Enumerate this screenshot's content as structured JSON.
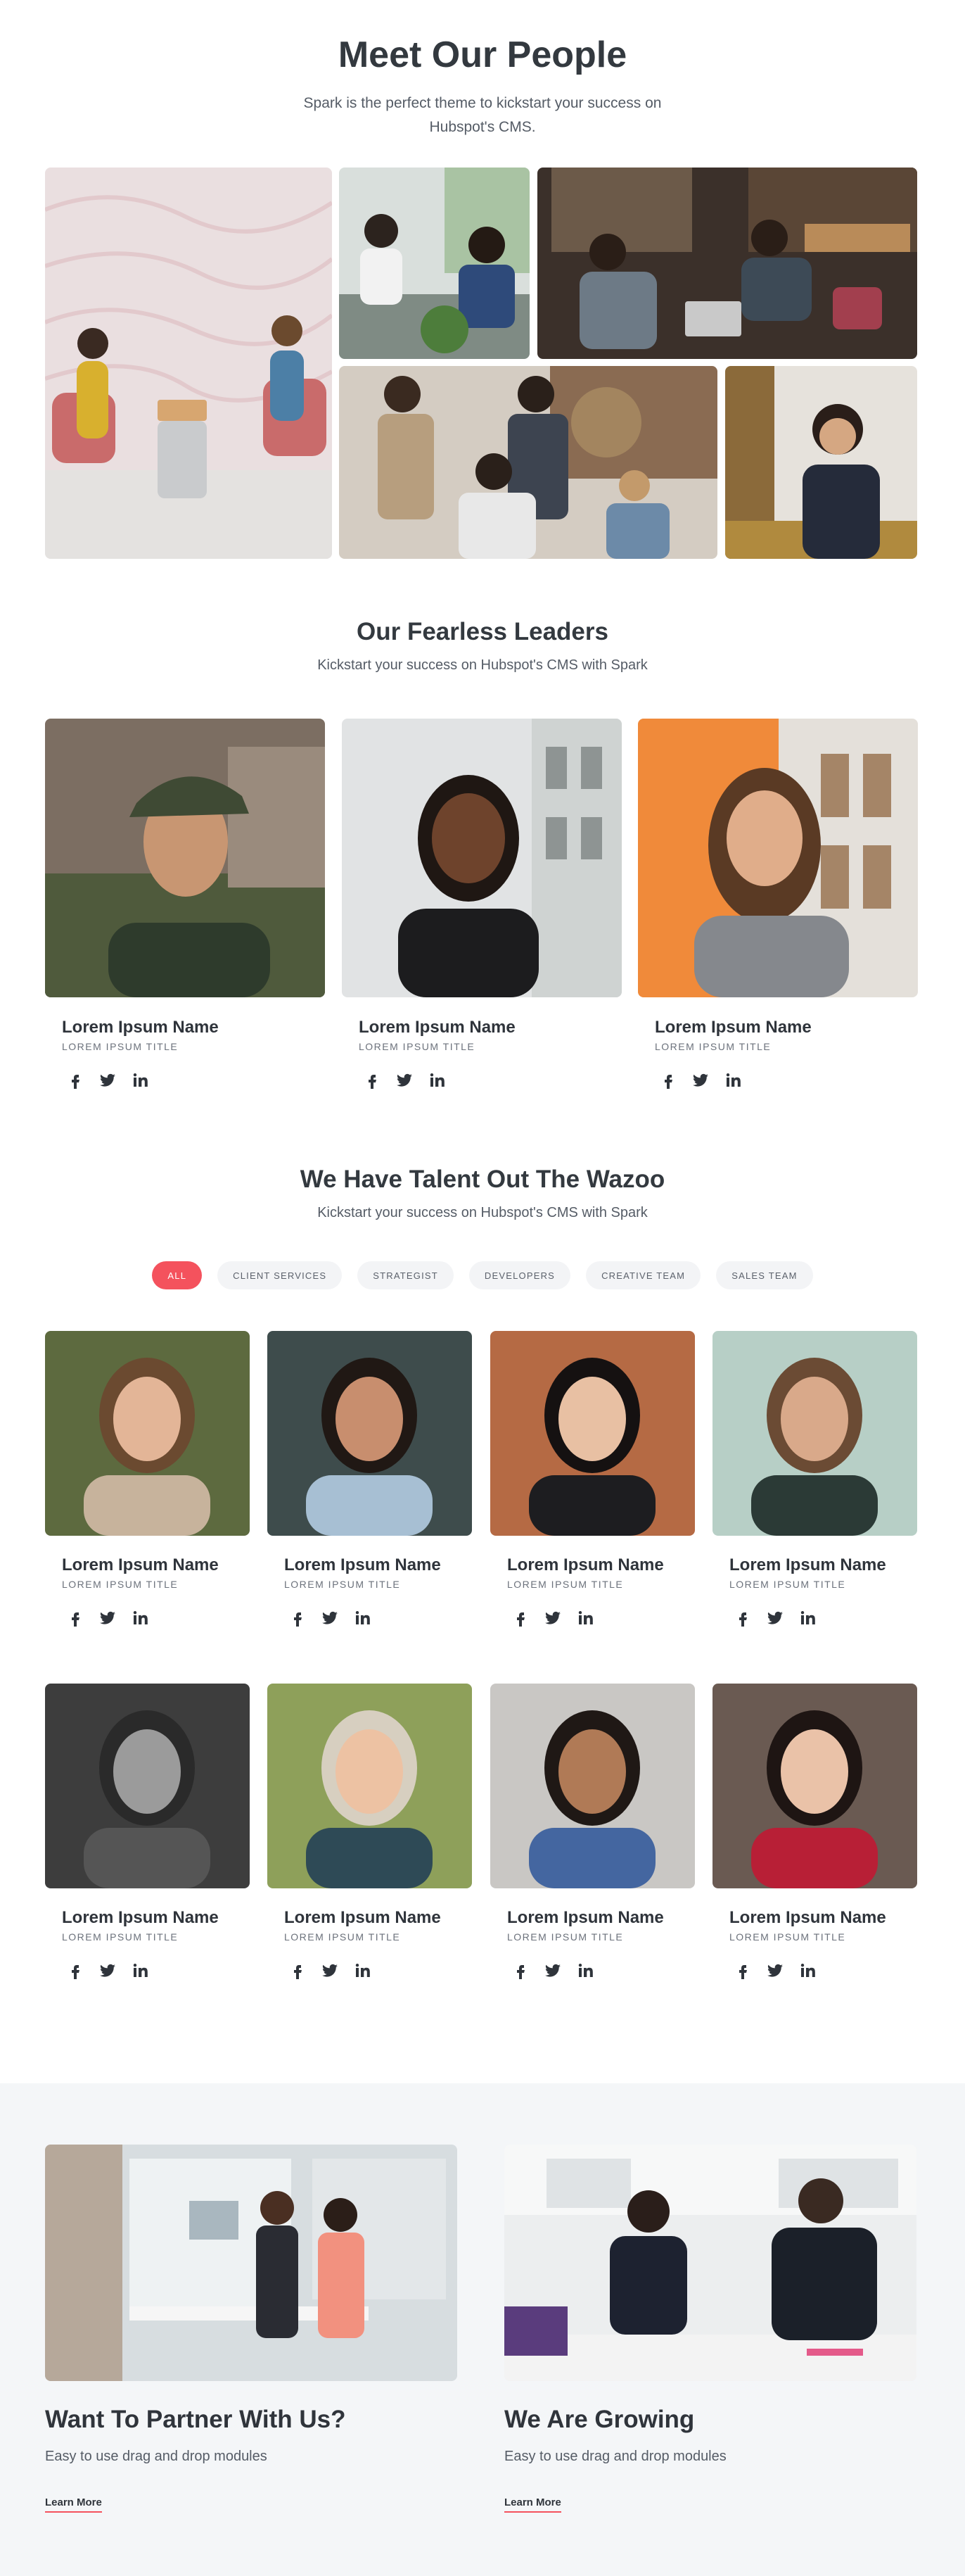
{
  "hero": {
    "title": "Meet Our People",
    "subtitle": "Spark is the perfect theme to kickstart your success on Hubspot's CMS."
  },
  "leaders": {
    "title": "Our Fearless Leaders",
    "subtitle": "Kickstart your success on Hubspot's CMS with Spark",
    "people": [
      {
        "name": "Lorem Ipsum Name",
        "role": "LOREM IPSUM TITLE"
      },
      {
        "name": "Lorem Ipsum Name",
        "role": "LOREM IPSUM TITLE"
      },
      {
        "name": "Lorem Ipsum Name",
        "role": "LOREM IPSUM TITLE"
      }
    ]
  },
  "talent": {
    "title": "We Have Talent Out The Wazoo",
    "subtitle": "Kickstart your success on Hubspot's CMS with Spark",
    "filters": [
      "ALL",
      "CLIENT SERVICES",
      "STRATEGIST",
      "DEVELOPERS",
      "CREATIVE TEAM",
      "SALES TEAM"
    ],
    "active_filter": "ALL",
    "people": [
      {
        "name": "Lorem Ipsum Name",
        "role": "LOREM IPSUM TITLE"
      },
      {
        "name": "Lorem Ipsum Name",
        "role": "LOREM IPSUM TITLE"
      },
      {
        "name": "Lorem Ipsum Name",
        "role": "LOREM IPSUM TITLE"
      },
      {
        "name": "Lorem Ipsum Name",
        "role": "LOREM IPSUM TITLE"
      },
      {
        "name": "Lorem Ipsum Name",
        "role": "LOREM IPSUM TITLE"
      },
      {
        "name": "Lorem Ipsum Name",
        "role": "LOREM IPSUM TITLE"
      },
      {
        "name": "Lorem Ipsum Name",
        "role": "LOREM IPSUM TITLE"
      },
      {
        "name": "Lorem Ipsum Name",
        "role": "LOREM IPSUM TITLE"
      }
    ]
  },
  "promos": [
    {
      "title": "Want To Partner With Us?",
      "subtitle": "Easy to use drag and drop modules",
      "link": "Learn More"
    },
    {
      "title": "We Are Growing",
      "subtitle": "Easy to use drag and drop modules",
      "link": "Learn More"
    }
  ],
  "social_icons": [
    "facebook-icon",
    "twitter-icon",
    "linkedin-icon"
  ],
  "colors": {
    "accent": "#f4525d",
    "text": "#2f343b",
    "muted": "#6b717b",
    "bottom_bg": "#f4f6f8"
  }
}
